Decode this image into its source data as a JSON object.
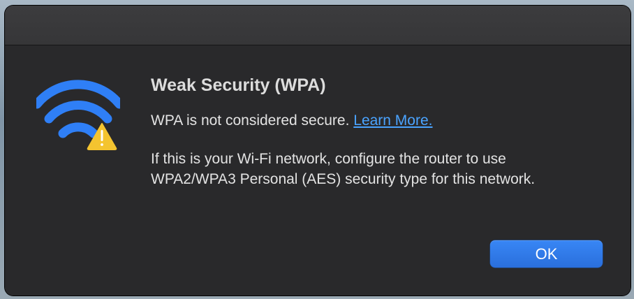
{
  "dialog": {
    "title": "Weak Security (WPA)",
    "message_line1": "WPA is not considered secure.",
    "learn_more_label": "Learn More.",
    "detail_line1": "If this is your Wi-Fi network, configure the router to use",
    "detail_line2": "WPA2/WPA3 Personal (AES) security type for this network.",
    "ok_label": "OK"
  },
  "icons": {
    "main": "wifi-icon",
    "badge": "warning-icon"
  },
  "colors": {
    "wifi_blue": "#2f7ff6",
    "warning_yellow": "#f4c430",
    "link_blue": "#4aa3ff",
    "button_blue": "#2f7bea",
    "dialog_background": "#29292b"
  }
}
